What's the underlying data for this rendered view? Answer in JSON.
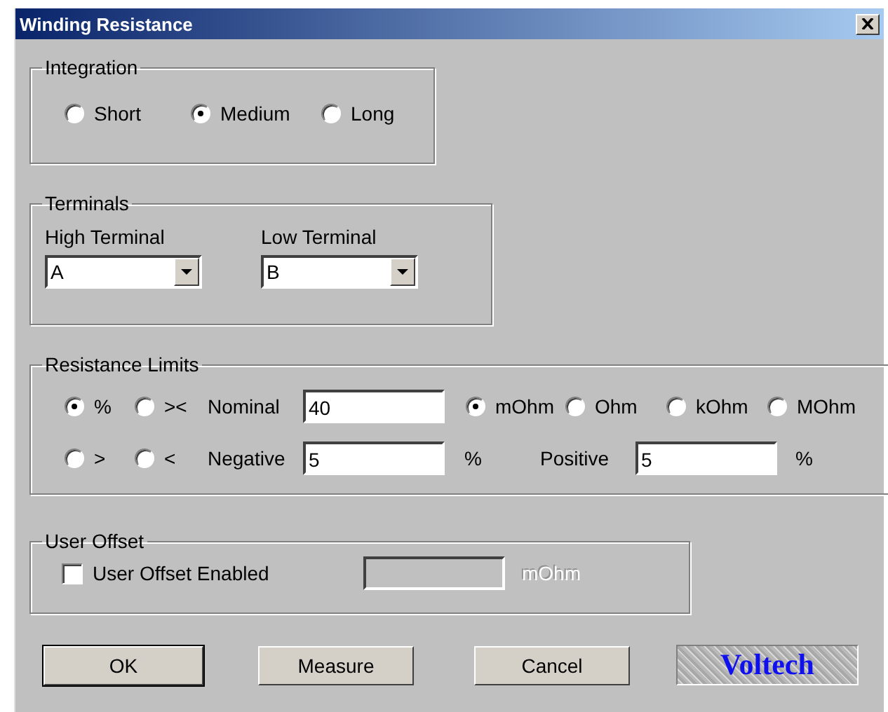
{
  "window": {
    "title": "Winding Resistance"
  },
  "integration": {
    "legend": "Integration",
    "options": [
      {
        "label": "Short",
        "selected": false
      },
      {
        "label": "Medium",
        "selected": true
      },
      {
        "label": "Long",
        "selected": false
      }
    ]
  },
  "terminals": {
    "legend": "Terminals",
    "fields": [
      {
        "label": "High Terminal",
        "value": "A"
      },
      {
        "label": "Low Terminal",
        "value": "B"
      }
    ]
  },
  "resistance_limits": {
    "legend": "Resistance Limits",
    "modes_row1": [
      {
        "label": "%",
        "selected": true
      },
      {
        "label": "><",
        "selected": false
      }
    ],
    "modes_row2": [
      {
        "label": ">",
        "selected": false
      },
      {
        "label": "<",
        "selected": false
      }
    ],
    "nominal": {
      "label": "Nominal",
      "value": "40"
    },
    "units": [
      {
        "label": "mOhm",
        "selected": true
      },
      {
        "label": "Ohm",
        "selected": false
      },
      {
        "label": "kOhm",
        "selected": false
      },
      {
        "label": "MOhm",
        "selected": false
      }
    ],
    "negative": {
      "label": "Negative",
      "value": "5",
      "unit": "%"
    },
    "positive": {
      "label": "Positive",
      "value": "5",
      "unit": "%"
    }
  },
  "user_offset": {
    "legend": "User Offset",
    "checkbox": {
      "label": "User Offset Enabled",
      "checked": false
    },
    "field": {
      "disabled": true,
      "unit": "mOhm"
    }
  },
  "buttons": [
    {
      "label": "OK",
      "default": true
    },
    {
      "label": "Measure",
      "default": false
    },
    {
      "label": "Cancel",
      "default": false
    }
  ],
  "logo": {
    "text": "Voltech"
  }
}
